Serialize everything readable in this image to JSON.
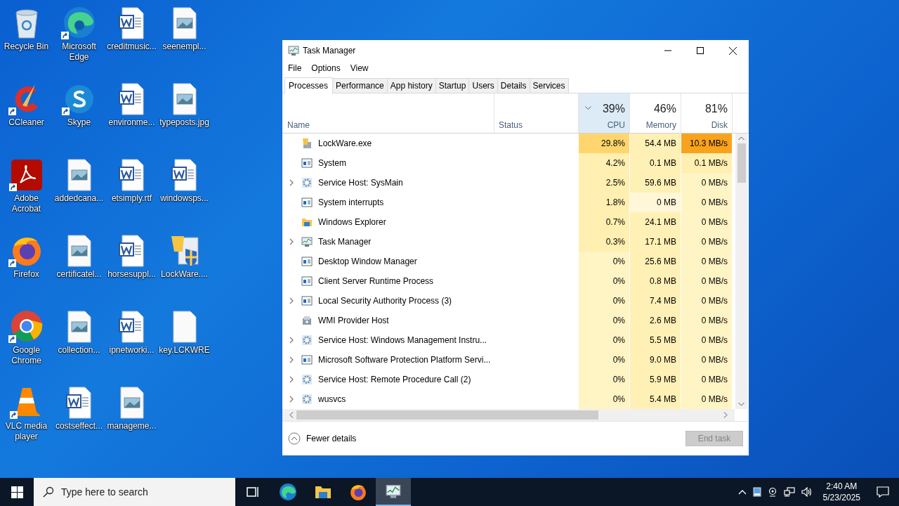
{
  "desktop_icons": [
    {
      "label": "Recycle Bin",
      "kind": "recycle",
      "shortcut": false
    },
    {
      "label": "Microsoft Edge",
      "kind": "edge",
      "shortcut": true
    },
    {
      "label": "creditmusic...",
      "kind": "word",
      "shortcut": false
    },
    {
      "label": "seenempl...",
      "kind": "image",
      "shortcut": false
    },
    {
      "label": "CCleaner",
      "kind": "ccleaner",
      "shortcut": true
    },
    {
      "label": "Skype",
      "kind": "skype",
      "shortcut": true
    },
    {
      "label": "environme...",
      "kind": "word",
      "shortcut": false
    },
    {
      "label": "typeposts.jpg",
      "kind": "image",
      "shortcut": false
    },
    {
      "label": "Adobe Acrobat",
      "kind": "acrobat",
      "shortcut": true
    },
    {
      "label": "addedcana...",
      "kind": "image",
      "shortcut": false
    },
    {
      "label": "etsimply.rtf",
      "kind": "word",
      "shortcut": false
    },
    {
      "label": "windowsps...",
      "kind": "word",
      "shortcut": false
    },
    {
      "label": "Firefox",
      "kind": "firefox",
      "shortcut": true
    },
    {
      "label": "certificatel...",
      "kind": "image",
      "shortcut": false
    },
    {
      "label": "horsesuppl...",
      "kind": "word",
      "shortcut": false
    },
    {
      "label": "LockWare....",
      "kind": "lockware",
      "shortcut": false
    },
    {
      "label": "Google Chrome",
      "kind": "chrome",
      "shortcut": true
    },
    {
      "label": "collection...",
      "kind": "image",
      "shortcut": false
    },
    {
      "label": "ipnetworki...",
      "kind": "word",
      "shortcut": false
    },
    {
      "label": "key.LCKWRE",
      "kind": "blank",
      "shortcut": false
    },
    {
      "label": "VLC media player",
      "kind": "vlc",
      "shortcut": true
    },
    {
      "label": "costseffect...",
      "kind": "word",
      "shortcut": false
    },
    {
      "label": "manageme...",
      "kind": "image",
      "shortcut": false
    }
  ],
  "window": {
    "title": "Task Manager",
    "menu": [
      "File",
      "Options",
      "View"
    ],
    "tabs": [
      {
        "label": "Processes",
        "selected": true
      },
      {
        "label": "Performance",
        "selected": false
      },
      {
        "label": "App history",
        "selected": false
      },
      {
        "label": "Startup",
        "selected": false
      },
      {
        "label": "Users",
        "selected": false
      },
      {
        "label": "Details",
        "selected": false
      },
      {
        "label": "Services",
        "selected": false
      }
    ],
    "columns": [
      {
        "kind": "name",
        "label": "Name"
      },
      {
        "kind": "status",
        "label": "Status"
      },
      {
        "kind": "metric",
        "percent": "39%",
        "label": "CPU",
        "selected": true
      },
      {
        "kind": "metric",
        "percent": "46%",
        "label": "Memory",
        "selected": false
      },
      {
        "kind": "metric",
        "percent": "81%",
        "label": "Disk",
        "selected": false
      }
    ],
    "rows": [
      {
        "kind": "lockware",
        "expandable": false,
        "cells": [
          {
            "text": "LockWare.exe"
          },
          {
            "text": ""
          },
          {
            "text": "29.8%",
            "color": "#ffd66e"
          },
          {
            "text": "54.4 MB",
            "color": "#fff0b5"
          },
          {
            "text": "10.3 MB/s",
            "color": "#f9a31c"
          }
        ]
      },
      {
        "kind": "window",
        "expandable": false,
        "cells": [
          {
            "text": "System"
          },
          {
            "text": ""
          },
          {
            "text": "4.2%",
            "color": "#ffefb0"
          },
          {
            "text": "0.1 MB",
            "color": "#fff0b5"
          },
          {
            "text": "0.1 MB/s",
            "color": "#ffefb0"
          }
        ]
      },
      {
        "kind": "gear",
        "expandable": true,
        "cells": [
          {
            "text": "Service Host: SysMain"
          },
          {
            "text": ""
          },
          {
            "text": "2.5%",
            "color": "#ffefb0"
          },
          {
            "text": "59.6 MB",
            "color": "#fff0b5"
          },
          {
            "text": "0 MB/s",
            "color": "#fff4c4"
          }
        ]
      },
      {
        "kind": "window",
        "expandable": false,
        "cells": [
          {
            "text": "System interrupts"
          },
          {
            "text": ""
          },
          {
            "text": "1.8%",
            "color": "#ffefb0"
          },
          {
            "text": "0 MB",
            "color": "#fff7d8"
          },
          {
            "text": "0 MB/s",
            "color": "#fff4c4"
          }
        ]
      },
      {
        "kind": "folder",
        "expandable": false,
        "cells": [
          {
            "text": "Windows Explorer"
          },
          {
            "text": ""
          },
          {
            "text": "0.7%",
            "color": "#ffefb0"
          },
          {
            "text": "24.1 MB",
            "color": "#fff0b5"
          },
          {
            "text": "0 MB/s",
            "color": "#fff4c4"
          }
        ]
      },
      {
        "kind": "taskmgr",
        "expandable": true,
        "cells": [
          {
            "text": "Task Manager"
          },
          {
            "text": ""
          },
          {
            "text": "0.3%",
            "color": "#ffefb0"
          },
          {
            "text": "17.1 MB",
            "color": "#fff0b5"
          },
          {
            "text": "0 MB/s",
            "color": "#fff4c4"
          }
        ]
      },
      {
        "kind": "window",
        "expandable": false,
        "cells": [
          {
            "text": "Desktop Window Manager"
          },
          {
            "text": ""
          },
          {
            "text": "0%",
            "color": "#fff4c4"
          },
          {
            "text": "25.6 MB",
            "color": "#fff0b5"
          },
          {
            "text": "0 MB/s",
            "color": "#fff4c4"
          }
        ]
      },
      {
        "kind": "window",
        "expandable": false,
        "cells": [
          {
            "text": "Client Server Runtime Process"
          },
          {
            "text": ""
          },
          {
            "text": "0%",
            "color": "#fff4c4"
          },
          {
            "text": "0.8 MB",
            "color": "#fff0b5"
          },
          {
            "text": "0 MB/s",
            "color": "#fff4c4"
          }
        ]
      },
      {
        "kind": "window",
        "expandable": true,
        "cells": [
          {
            "text": "Local Security Authority Process (3)"
          },
          {
            "text": ""
          },
          {
            "text": "0%",
            "color": "#fff4c4"
          },
          {
            "text": "7.4 MB",
            "color": "#fff0b5"
          },
          {
            "text": "0 MB/s",
            "color": "#fff4c4"
          }
        ]
      },
      {
        "kind": "wmi",
        "expandable": false,
        "cells": [
          {
            "text": "WMI Provider Host"
          },
          {
            "text": ""
          },
          {
            "text": "0%",
            "color": "#fff4c4"
          },
          {
            "text": "2.6 MB",
            "color": "#fff0b5"
          },
          {
            "text": "0 MB/s",
            "color": "#fff4c4"
          }
        ]
      },
      {
        "kind": "gear",
        "expandable": true,
        "cells": [
          {
            "text": "Service Host: Windows Management Instru..."
          },
          {
            "text": ""
          },
          {
            "text": "0%",
            "color": "#fff4c4"
          },
          {
            "text": "5.5 MB",
            "color": "#fff0b5"
          },
          {
            "text": "0 MB/s",
            "color": "#fff4c4"
          }
        ]
      },
      {
        "kind": "window",
        "expandable": true,
        "cells": [
          {
            "text": "Microsoft Software Protection Platform Servi..."
          },
          {
            "text": ""
          },
          {
            "text": "0%",
            "color": "#fff4c4"
          },
          {
            "text": "9.0 MB",
            "color": "#fff0b5"
          },
          {
            "text": "0 MB/s",
            "color": "#fff4c4"
          }
        ]
      },
      {
        "kind": "gear",
        "expandable": true,
        "cells": [
          {
            "text": "Service Host: Remote Procedure Call (2)"
          },
          {
            "text": ""
          },
          {
            "text": "0%",
            "color": "#fff4c4"
          },
          {
            "text": "5.9 MB",
            "color": "#fff0b5"
          },
          {
            "text": "0 MB/s",
            "color": "#fff4c4"
          }
        ]
      },
      {
        "kind": "gear",
        "expandable": true,
        "cells": [
          {
            "text": "wusvcs"
          },
          {
            "text": ""
          },
          {
            "text": "0%",
            "color": "#fff4c4"
          },
          {
            "text": "5.4 MB",
            "color": "#fff0b5"
          },
          {
            "text": "0 MB/s",
            "color": "#fff4c4"
          }
        ]
      }
    ],
    "footer": {
      "fewer_details": "Fewer details",
      "end_task": {
        "label": "End task",
        "disabled": true
      }
    }
  },
  "taskbar": {
    "search_placeholder": "Type here to search",
    "apps": [
      {
        "kind": "taskview",
        "active": false
      },
      {
        "kind": "edge",
        "active": false
      },
      {
        "kind": "folder",
        "active": false
      },
      {
        "kind": "firefox",
        "active": false
      },
      {
        "kind": "taskmgr",
        "active": true
      }
    ],
    "time": "2:40 AM",
    "date": "5/23/2025"
  }
}
